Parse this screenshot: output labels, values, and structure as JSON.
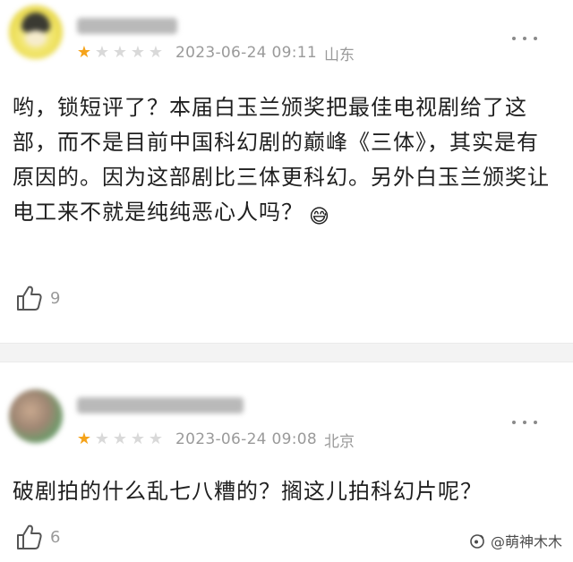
{
  "reviews": [
    {
      "rating": {
        "filled": 1,
        "total": 5,
        "filled_symbol": "★",
        "empty_symbol": "★"
      },
      "timestamp": "2023-06-24 09:11",
      "location": "山东",
      "body": "哟，锁短评了？本届白玉兰颁奖把最佳电视剧给了这部，而不是目前中国科幻剧的巅峰《三体》，其实是有原因的。因为这部剧比三体更科幻。另外白玉兰颁奖让电工来不就是纯纯恶心人吗？",
      "emoji": "😅",
      "likes": "9"
    },
    {
      "rating": {
        "filled": 1,
        "total": 5,
        "filled_symbol": "★",
        "empty_symbol": "★"
      },
      "timestamp": "2023-06-24 09:08",
      "location": "北京",
      "body": "破剧拍的什么乱七八糟的？搁这儿拍科幻片呢？",
      "likes": "6"
    }
  ],
  "watermark": "@萌神木木",
  "colors": {
    "star_filled": "#f5a31a",
    "star_empty": "#d9d9d9",
    "meta_text": "#9a9a9a",
    "divider": "#f3f3f3"
  },
  "icons": {
    "more": "vertical-ellipsis-icon",
    "like": "thumbs-up-icon",
    "watermark": "weibo-logo-icon"
  }
}
